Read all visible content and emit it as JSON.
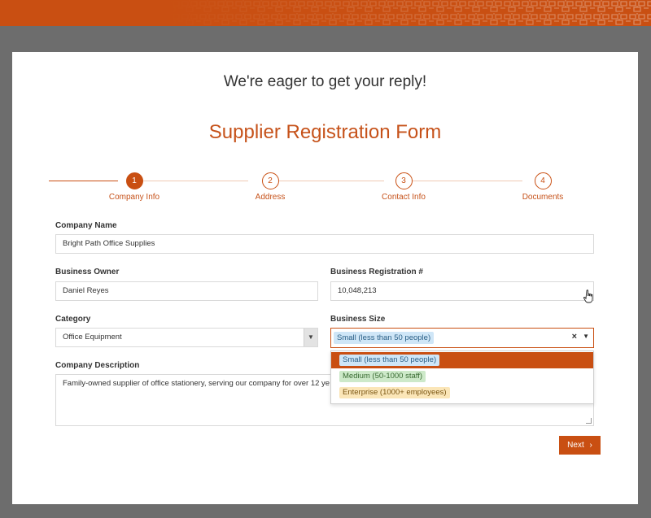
{
  "header": {
    "tagline": "We're eager to get your reply!",
    "form_title": "Supplier Registration Form"
  },
  "steps": [
    {
      "number": "1",
      "label": "Company Info",
      "active": true
    },
    {
      "number": "2",
      "label": "Address",
      "active": false
    },
    {
      "number": "3",
      "label": "Contact Info",
      "active": false
    },
    {
      "number": "4",
      "label": "Documents",
      "active": false
    }
  ],
  "fields": {
    "company_name": {
      "label": "Company Name",
      "value": "Bright Path Office Supplies"
    },
    "business_owner": {
      "label": "Business Owner",
      "value": "Daniel Reyes"
    },
    "registration": {
      "label": "Business Registration #",
      "value": "10,048,213"
    },
    "category": {
      "label": "Category",
      "value": "Office Equipment"
    },
    "business_size": {
      "label": "Business Size",
      "value": "Small (less than 50 people)",
      "options": [
        "Small (less than 50 people)",
        "Medium (50-1000 staff)",
        "Enterprise (1000+ employees)"
      ]
    },
    "description": {
      "label": "Company Description",
      "value": "Family-owned supplier of office stationery, serving our company for over 12 ye"
    }
  },
  "actions": {
    "next_label": "Next",
    "clear_glyph": "×",
    "next_glyph": "›"
  },
  "colors": {
    "accent": "#c94f12",
    "background": "#6d6d6d"
  }
}
